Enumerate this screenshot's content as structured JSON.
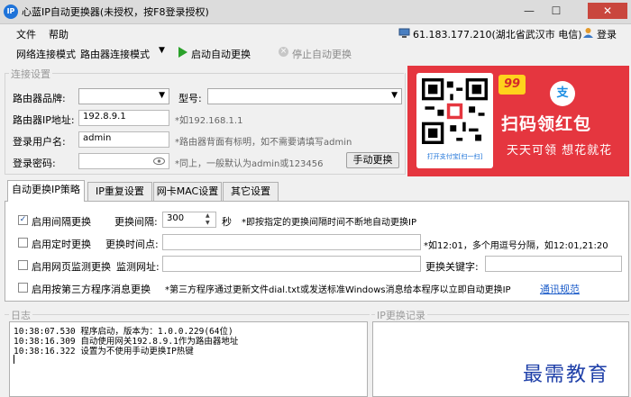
{
  "window": {
    "title": "心蓝IP自动更换器(未授权，按F8登录授权)",
    "app_icon_text": "IP",
    "minimize": "—",
    "maximize": "☐",
    "close": "✕"
  },
  "menu": {
    "file": "文件",
    "help": "帮助",
    "ip_status": "61.183.177.210(湖北省武汉市 电信)",
    "login": "登录"
  },
  "toolbar": {
    "mode_label": "网络连接模式",
    "mode_value": "路由器连接模式",
    "start": "启动自动更换",
    "stop": "停止自动更换"
  },
  "connection": {
    "group_title": "连接设置",
    "brand_label": "路由器品牌:",
    "brand_value": "",
    "model_label": "型号:",
    "model_value": "",
    "ip_label": "路由器IP地址:",
    "ip_value": "192.8.9.1",
    "ip_hint": "*如192.168.1.1",
    "user_label": "登录用户名:",
    "user_value": "admin",
    "user_hint": "*路由器背面有标明，如不需要请填写admin",
    "pass_label": "登录密码:",
    "pass_value": "",
    "pass_hint": "*同上，一般默认为admin或123456",
    "manual_button": "手动更换"
  },
  "ad": {
    "badge": "99",
    "alipay_glyph": "支",
    "title": "扫码领红包",
    "subtitle": "天天可领 想花就花",
    "qr_caption": "打开支付宝[扫一扫]"
  },
  "tabs": [
    {
      "label": "自动更换IP策略",
      "active": true
    },
    {
      "label": "IP重复设置",
      "active": false
    },
    {
      "label": "网卡MAC设置",
      "active": false
    },
    {
      "label": "其它设置",
      "active": false
    }
  ],
  "strategy": {
    "interval_checked": true,
    "interval_label": "启用间隔更换",
    "interval_field_label": "更换间隔:",
    "interval_value": "300",
    "interval_unit": "秒",
    "interval_hint": "*即按指定的更换间隔时间不断地自动更换IP",
    "timed_label": "启用定时更换",
    "timed_field_label": "更换时间点:",
    "timed_value": "",
    "timed_hint": "*如12:01，多个用逗号分隔，如12:01,21:20",
    "monitor_label": "启用网页监测更换",
    "monitor_url_label": "监测网址:",
    "monitor_url_value": "",
    "keyword_label": "更换关键字:",
    "keyword_value": "",
    "thirdparty_label": "启用按第三方程序消息更换",
    "thirdparty_hint": "*第三方程序通过更新文件dial.txt或发送标准Windows消息给本程序以立即自动更换IP",
    "thirdparty_link": "通讯规范"
  },
  "log": {
    "title": "日志",
    "lines": [
      "10:38:07.530 程序启动，版本为：1.0.0.229(64位)",
      "10:38:16.309 自动使用网关192.8.9.1作为路由器地址",
      "10:38:16.322 设置为不使用手动更换IP热键"
    ]
  },
  "ip_log": {
    "title": "IP更换记录"
  },
  "watermark": "最需教育",
  "colors": {
    "ad_red": "#e5363f",
    "link_blue": "#1a5bc9",
    "start_green": "#2aa12a",
    "close_red": "#c9463d"
  }
}
